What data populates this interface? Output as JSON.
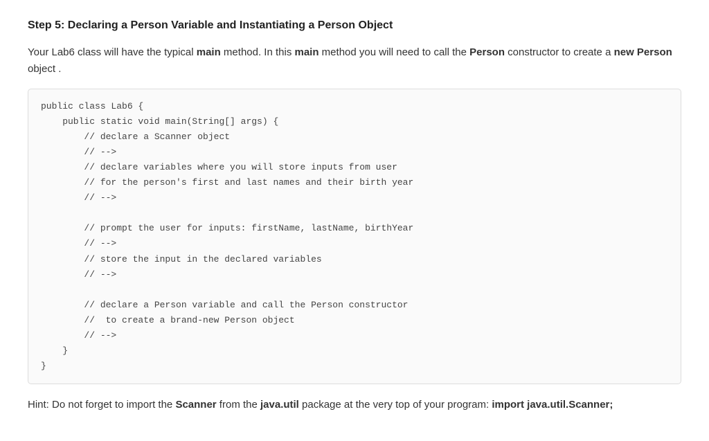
{
  "heading": "Step 5: Declaring a Person Variable and Instantiating a Person Object",
  "intro": {
    "t1": "Your Lab6 class will have the typical ",
    "b1": "main",
    "t2": " method. In this ",
    "b2": "main",
    "t3": " method you will need to call the ",
    "b3": "Person",
    "t4": " constructor to create a ",
    "b4": "new Person",
    "t5": " object ."
  },
  "code": "public class Lab6 {\n    public static void main(String[] args) {\n        // declare a Scanner object\n        // -->\n        // declare variables where you will store inputs from user\n        // for the person's first and last names and their birth year\n        // -->\n\n        // prompt the user for inputs: firstName, lastName, birthYear\n        // -->\n        // store the input in the declared variables\n        // -->\n\n        // declare a Person variable and call the Person constructor\n        //  to create a brand-new Person object\n        // -->\n    }\n}",
  "hint": {
    "t1": "Hint: Do not forget to import the ",
    "b1": "Scanner",
    "t2": " from the ",
    "b2": "java.util",
    "t3": " package at the very top of your program: ",
    "b3": "import java.util.Scanner;"
  }
}
